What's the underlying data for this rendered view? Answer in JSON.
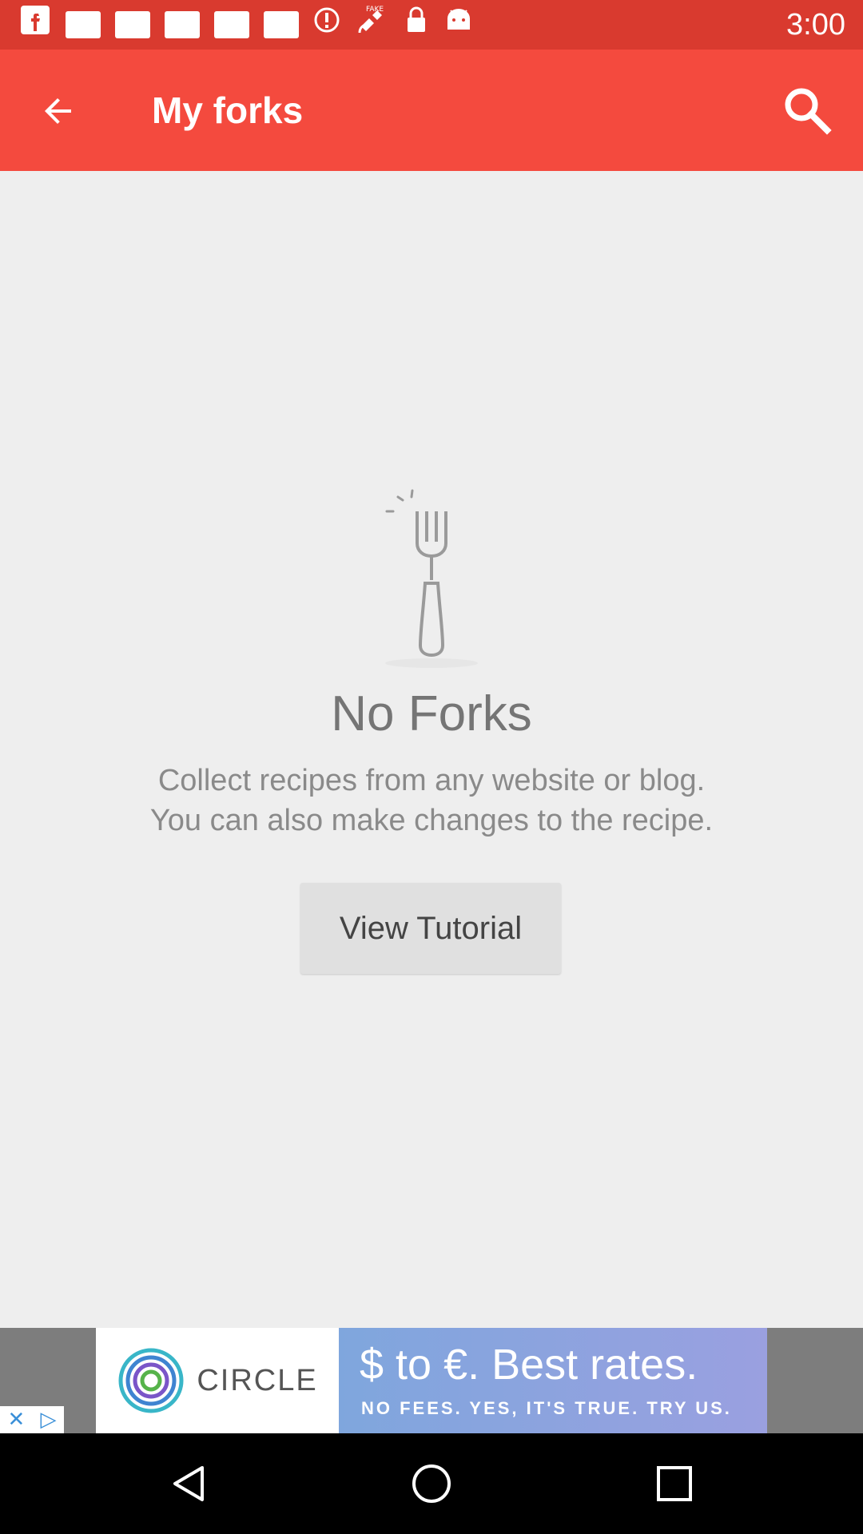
{
  "status_bar": {
    "time": "3:00",
    "icons": [
      "facebook-icon",
      "notification-square-icon",
      "notification-square-icon",
      "notification-square-icon",
      "notification-square-icon",
      "notification-square-icon",
      "alert-icon",
      "satellite-icon",
      "lock-icon",
      "android-icon"
    ],
    "fake_label": "FAKE"
  },
  "app_bar": {
    "title": "My forks",
    "back_icon": "arrow-back-icon",
    "search_icon": "search-icon",
    "color": "#f44a3e"
  },
  "empty_state": {
    "illustration": "fork-icon",
    "title": "No Forks",
    "description_line1": "Collect recipes from any website or blog.",
    "description_line2": "You can also make changes to the recipe.",
    "button_label": "View Tutorial"
  },
  "ad": {
    "brand": "CIRCLE",
    "headline": "$ to €. Best rates.",
    "subline": "NO FEES. YES, IT'S TRUE. TRY US.",
    "close_icon": "close-icon",
    "adchoices_icon": "adchoices-icon"
  },
  "nav_bar": {
    "buttons": [
      "back-triangle-icon",
      "home-circle-icon",
      "recents-square-icon"
    ]
  }
}
